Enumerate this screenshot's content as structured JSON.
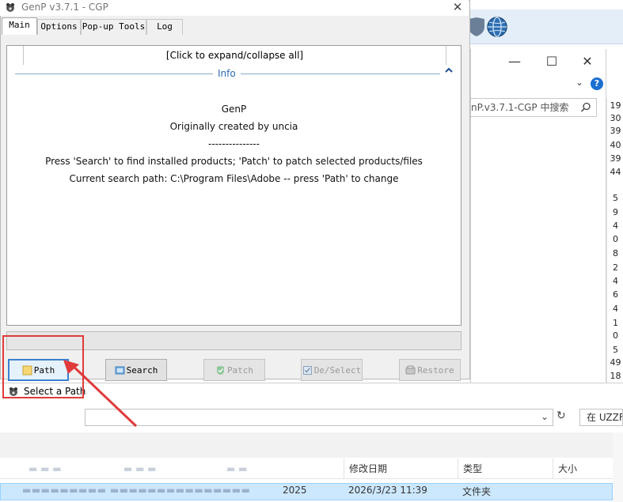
{
  "background_window": {
    "search_placeholder": "nP.v3.7.1-CGP 中搜索",
    "close_glyph": "✕",
    "maximize_glyph": "☐",
    "minimize_glyph": "—",
    "help_glyph": "?",
    "numbers": [
      "19",
      "30",
      "39",
      "40",
      "39",
      "44",
      "5",
      "9",
      "4",
      "0",
      "8",
      "2",
      "4",
      "6",
      "4",
      "1",
      "0",
      "5",
      "49",
      "18"
    ]
  },
  "genp": {
    "title": "GenP v3.7.1 - CGP",
    "close_glyph": "✕",
    "tabs": [
      {
        "label": "Main",
        "active": true
      },
      {
        "label": "Options",
        "active": false
      },
      {
        "label": "Pop-up Tools",
        "active": false
      },
      {
        "label": "Log",
        "active": false
      }
    ],
    "expand_label": "[Click to expand/collapse all]",
    "info_label": "Info",
    "info_lines": [
      "GenP",
      "Originally created by uncia",
      "---------------",
      "Press 'Search' to find installed products; 'Patch' to patch selected products/files",
      "Current search path: C:\\Program Files\\Adobe -- press 'Path' to change"
    ],
    "buttons": {
      "path": "Path",
      "search": "Search",
      "patch": "Patch",
      "deselect": "De/Select",
      "restore": "Restore"
    }
  },
  "dialog": {
    "title": "Select a Path",
    "search_placeholder": "在 UZZF",
    "columns": {
      "date": "修改日期",
      "type": "类型",
      "size": "大小"
    },
    "row": {
      "name_suffix": "2025",
      "date": "2026/3/23 11:39",
      "type": "文件夹"
    }
  },
  "colors": {
    "highlight": "#e03a3a",
    "info_accent": "#2d6ab1",
    "selected_row": "#cce8ff"
  }
}
